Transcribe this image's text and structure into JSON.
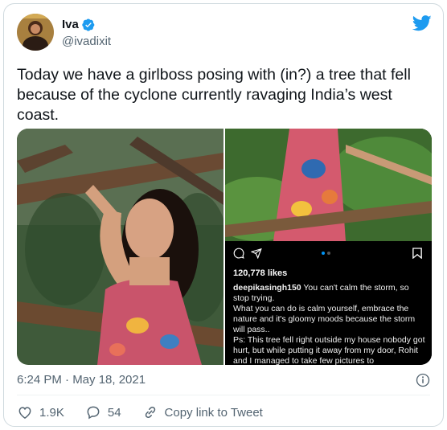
{
  "author": {
    "name": "Iva",
    "handle": "@ivadixit"
  },
  "tweet": {
    "text": "Today we have a girlboss posing with (in?) a tree that fell because of the cyclone currently ravaging India’s west coast.",
    "timestamp": "6:24 PM · May 18, 2021"
  },
  "instagram_post": {
    "likes": "120,778 likes",
    "username": "deepikasingh150",
    "caption_lines": [
      " You can't calm the storm, so stop trying.",
      "What you can do is calm yourself, embrace the nature and it's gloomy moods because the storm will pass..",
      "Ps: This tree fell right outside my house nobody got hurt, but while putting it away from my door, Rohit and I managed to take few pictures to"
    ]
  },
  "engagement": {
    "likes": "1.9K",
    "replies": "54",
    "copy_link_label": "Copy link to Tweet"
  },
  "icons": {
    "brand": "twitter-bird-icon",
    "verified": "verified-badge-icon",
    "like": "heart-icon",
    "reply": "reply-icon",
    "link": "link-icon",
    "info": "info-icon"
  },
  "colors": {
    "twitter_blue": "#1d9bf0",
    "text_primary": "#0f1419",
    "text_secondary": "#536471",
    "border": "#cfd9de"
  }
}
